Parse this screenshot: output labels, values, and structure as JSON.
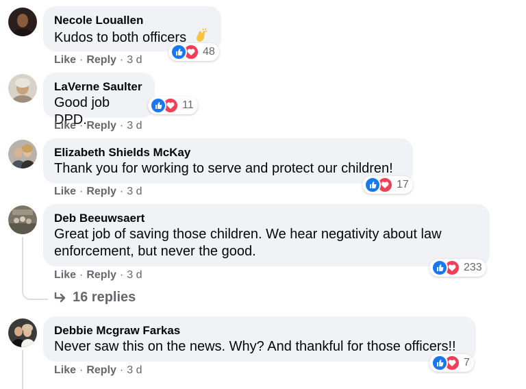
{
  "colors": {
    "bubble": "#f0f2f5",
    "secondary_text": "#65676b",
    "like_blue": "#1877f2",
    "love_red": "#f33e58"
  },
  "actions": {
    "like": "Like",
    "reply": "Reply",
    "sep": "·"
  },
  "comments": [
    {
      "author": "Necole Louallen",
      "text": "Kudos to both officers",
      "emoji": "clapping-hands",
      "reaction_count": "48",
      "time": "3 d"
    },
    {
      "author": "LaVerne Saulter",
      "text": "Good job DPD.",
      "reaction_count": "11",
      "time": "3 d"
    },
    {
      "author": "Elizabeth Shields McKay",
      "text": "Thank you for working to serve and protect our children!",
      "reaction_count": "17",
      "time": "3 d"
    },
    {
      "author": "Deb Beeuwsaert",
      "text_line1": "Great job of saving those children. We hear negativity about law",
      "text_line2": "enforcement, but never the good.",
      "reaction_count": "233",
      "time": "3 d",
      "replies_label": "16 replies"
    },
    {
      "author": "Debbie Mcgraw Farkas",
      "text": "Never saw this on the news. Why? And thankful for those officers!!",
      "reaction_count": "7",
      "time": "3 d"
    }
  ]
}
